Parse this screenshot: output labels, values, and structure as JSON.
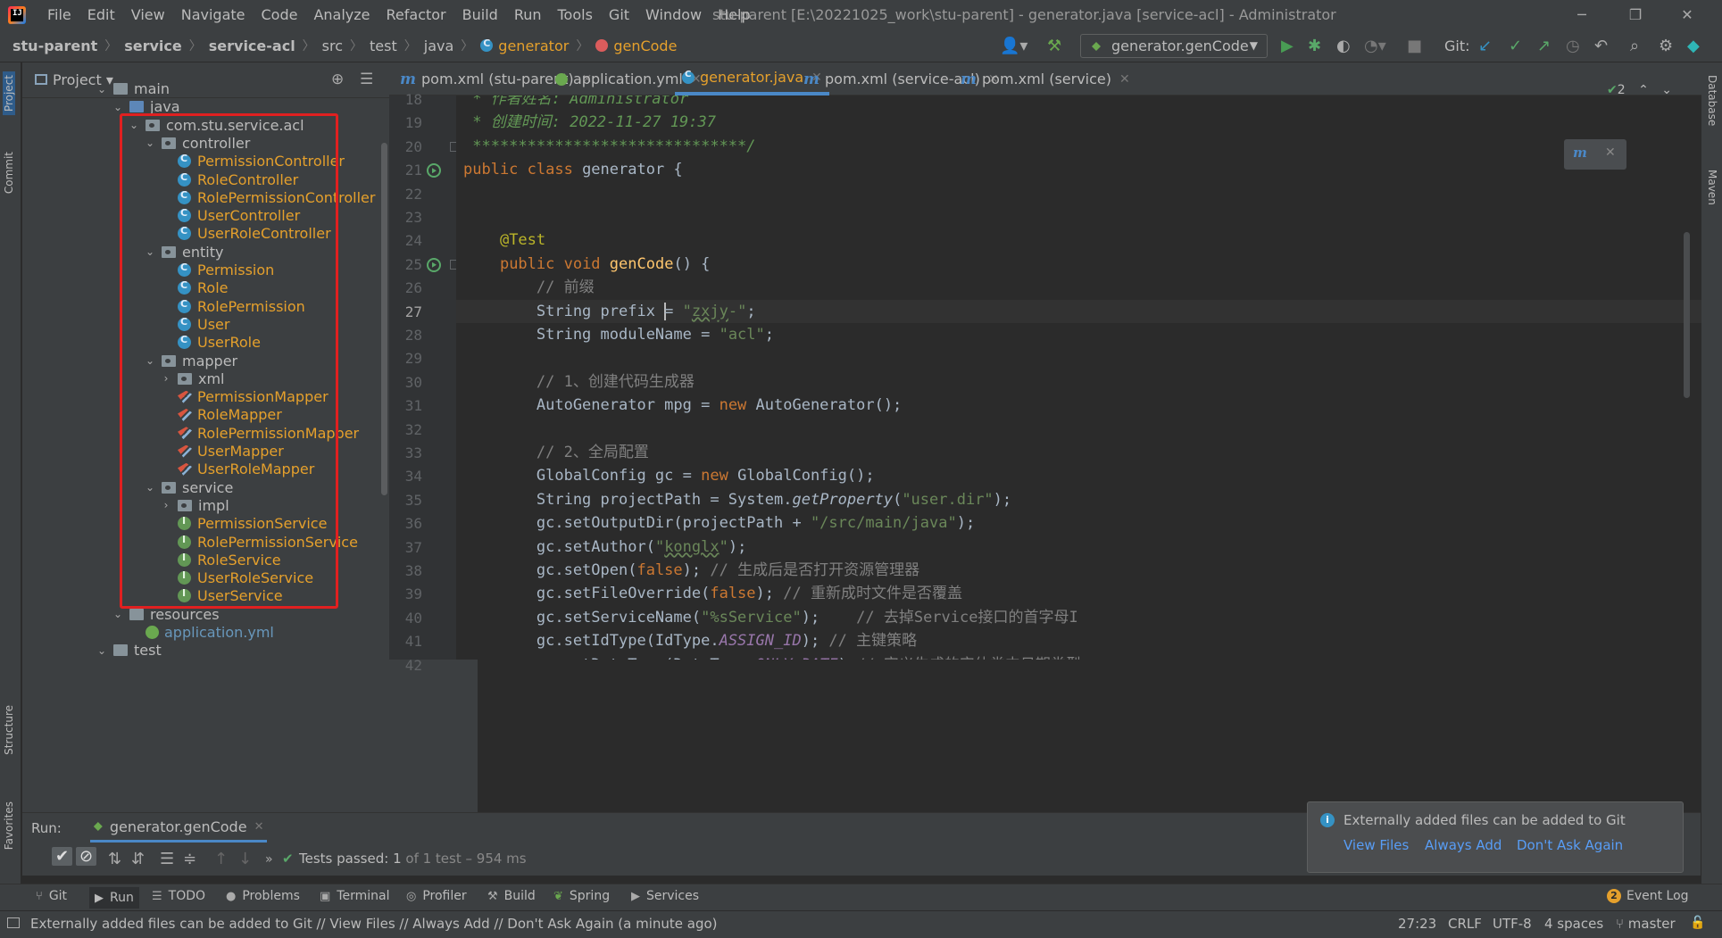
{
  "title_bar": {
    "menu": [
      "File",
      "Edit",
      "View",
      "Navigate",
      "Code",
      "Analyze",
      "Refactor",
      "Build",
      "Run",
      "Tools",
      "Git",
      "Window",
      "Help"
    ],
    "window_title": "stu-parent [E:\\20221025_work\\stu-parent] - generator.java [service-acl] - Administrator",
    "minimize": "─",
    "restore": "❐",
    "close": "✕"
  },
  "breadcrumb": [
    "stu-parent",
    "service",
    "service-acl",
    "src",
    "test",
    "java",
    "generator",
    "genCode"
  ],
  "toolbar": {
    "run_config": "generator.genCode",
    "git_label": "Git:"
  },
  "project_panel": {
    "title": "Project",
    "tree": [
      {
        "label": "main",
        "type": "folder"
      },
      {
        "label": "java",
        "type": "folder-blue"
      },
      {
        "label": "com.stu.service.acl",
        "type": "package"
      },
      {
        "label": "controller",
        "type": "package"
      },
      {
        "label": "PermissionController",
        "type": "class"
      },
      {
        "label": "RoleController",
        "type": "class"
      },
      {
        "label": "RolePermissionController",
        "type": "class"
      },
      {
        "label": "UserController",
        "type": "class"
      },
      {
        "label": "UserRoleController",
        "type": "class"
      },
      {
        "label": "entity",
        "type": "package"
      },
      {
        "label": "Permission",
        "type": "class"
      },
      {
        "label": "Role",
        "type": "class"
      },
      {
        "label": "RolePermission",
        "type": "class"
      },
      {
        "label": "User",
        "type": "class"
      },
      {
        "label": "UserRole",
        "type": "class"
      },
      {
        "label": "mapper",
        "type": "package"
      },
      {
        "label": "xml",
        "type": "package"
      },
      {
        "label": "PermissionMapper",
        "type": "mapper"
      },
      {
        "label": "RoleMapper",
        "type": "mapper"
      },
      {
        "label": "RolePermissionMapper",
        "type": "mapper"
      },
      {
        "label": "UserMapper",
        "type": "mapper"
      },
      {
        "label": "UserRoleMapper",
        "type": "mapper"
      },
      {
        "label": "service",
        "type": "package"
      },
      {
        "label": "impl",
        "type": "package"
      },
      {
        "label": "PermissionService",
        "type": "interface"
      },
      {
        "label": "RolePermissionService",
        "type": "interface"
      },
      {
        "label": "RoleService",
        "type": "interface"
      },
      {
        "label": "UserRoleService",
        "type": "interface"
      },
      {
        "label": "UserService",
        "type": "interface"
      },
      {
        "label": "resources",
        "type": "folder-res"
      },
      {
        "label": "application.yml",
        "type": "yml"
      },
      {
        "label": "test",
        "type": "folder"
      }
    ]
  },
  "editor_tabs": [
    {
      "label": "pom.xml (stu-parent)",
      "icon": "maven-icon",
      "active": false
    },
    {
      "label": "application.yml",
      "icon": "yml-icon",
      "active": false
    },
    {
      "label": "generator.java",
      "icon": "class-icon",
      "active": true
    },
    {
      "label": "pom.xml (service-acl)",
      "icon": "maven-icon",
      "active": false
    },
    {
      "label": "pom.xml (service)",
      "icon": "maven-icon",
      "active": false
    }
  ],
  "editor": {
    "inspection_count": "2",
    "line_numbers": [
      "18",
      "19",
      "20",
      "21",
      "22",
      "23",
      "24",
      "25",
      "26",
      "27",
      "28",
      "29",
      "30",
      "31",
      "32",
      "33",
      "34",
      "35",
      "36",
      "37",
      "38",
      "39",
      "40",
      "41",
      "42"
    ],
    "current_line": "27"
  },
  "run_panel": {
    "label": "Run:",
    "tab": "generator.genCode",
    "result_prefix": "Tests passed:",
    "result_count": "1",
    "result_suffix": "of 1 test – 954 ms"
  },
  "tool_windows": [
    "Git",
    "Run",
    "TODO",
    "Problems",
    "Terminal",
    "Profiler",
    "Build",
    "Spring",
    "Services"
  ],
  "event_log": {
    "count": "2",
    "label": "Event Log"
  },
  "notification": {
    "message": "Externally added files can be added to Git",
    "actions": [
      "View Files",
      "Always Add",
      "Don't Ask Again"
    ]
  },
  "status_bar": {
    "message": "Externally added files can be added to Git // View Files // Always Add // Don't Ask Again (a minute ago)",
    "position": "27:23",
    "line_sep": "CRLF",
    "encoding": "UTF-8",
    "indent": "4 spaces",
    "branch": "master"
  },
  "side_strips": {
    "left": [
      "Project",
      "Commit",
      "Structure",
      "Favorites"
    ],
    "right": [
      "Database",
      "Maven"
    ]
  }
}
